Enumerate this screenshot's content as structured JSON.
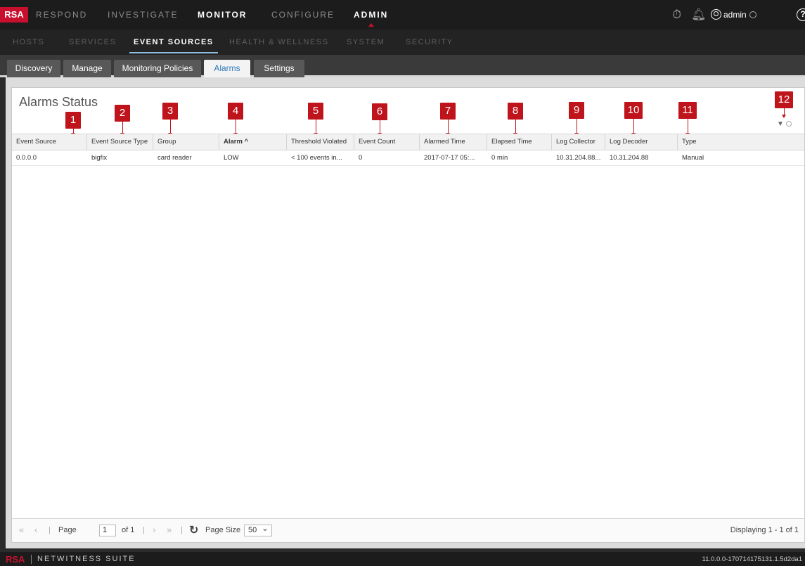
{
  "brand": {
    "logo": "RSA"
  },
  "topnav": {
    "items": [
      "RESPOND",
      "INVESTIGATE",
      "MONITOR",
      "CONFIGURE",
      "ADMIN"
    ],
    "user": "admin",
    "help": "?"
  },
  "subnav": {
    "items": [
      "HOSTS",
      "SERVICES",
      "EVENT SOURCES",
      "HEALTH & WELLNESS",
      "SYSTEM",
      "SECURITY"
    ],
    "active": "EVENT SOURCES"
  },
  "tabs": [
    "Discovery",
    "Manage",
    "Monitoring Policies",
    "Alarms",
    "Settings"
  ],
  "active_tab": "Alarms",
  "panel": {
    "title": "Alarms Status"
  },
  "table": {
    "columns": [
      "Event Source",
      "Event Source Type",
      "Group",
      "Alarm ^",
      "Threshold Violated",
      "Event Count",
      "Alarmed Time",
      "Elapsed Time",
      "Log Collector",
      "Log Decoder",
      "Type"
    ],
    "rows": [
      [
        "0.0.0.0",
        "bigfix",
        "card reader",
        "LOW",
        "< 100 events in...",
        "0",
        "2017-07-17 05:...",
        "0 min",
        "10.31.204.88...",
        "10.31.204.88",
        "Manual"
      ]
    ]
  },
  "callouts": [
    "1",
    "2",
    "3",
    "4",
    "5",
    "6",
    "7",
    "8",
    "9",
    "10",
    "11",
    "12"
  ],
  "pager": {
    "page_label": "Page",
    "page_value": "1",
    "of_label": "of 1",
    "page_size_label": "Page Size",
    "page_size": "50",
    "displaying": "Displaying 1 - 1 of 1"
  },
  "footer": {
    "logo": "RSA",
    "product": "NETWITNESS SUITE",
    "version": "11.0.0.0-170714175131.1.5d2da1"
  },
  "colors": {
    "brand_red": "#c8102e",
    "callout_red": "#c0141c",
    "active_tab_text": "#2f76b8"
  }
}
